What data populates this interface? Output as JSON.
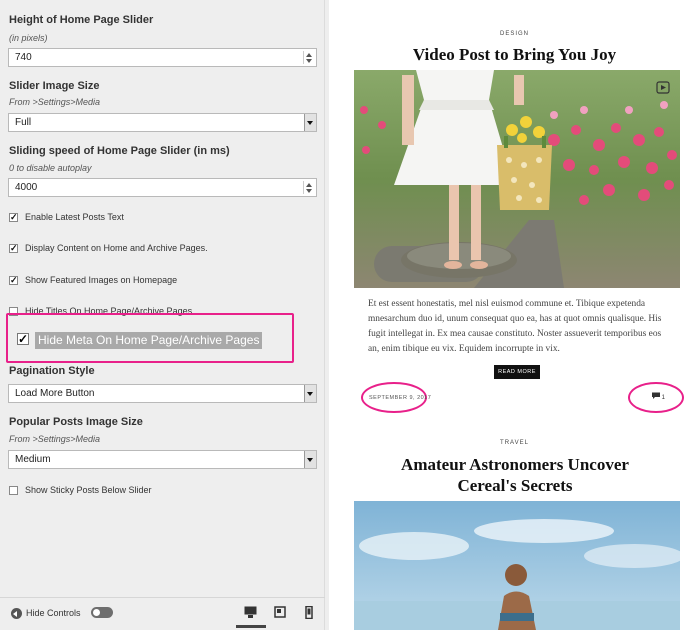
{
  "settings": {
    "slider_height": {
      "label": "Height of Home Page Slider",
      "hint": "(in pixels)",
      "value": "740"
    },
    "slider_image_size": {
      "label": "Slider Image Size",
      "hint": "From >Settings>Media",
      "value": "Full"
    },
    "slider_speed": {
      "label": "Sliding speed of Home Page Slider (in ms)",
      "hint": "0 to disable autoplay",
      "value": "4000"
    },
    "checkboxes": [
      {
        "label": "Enable Latest Posts Text",
        "checked": true
      },
      {
        "label": "Display Content on Home and Archive Pages.",
        "checked": true
      },
      {
        "label": "Show Featured Images on Homepage",
        "checked": true
      },
      {
        "label": "Hide Titles On Home Page/Archive Pages",
        "checked": false
      }
    ],
    "hide_meta": {
      "label": "Hide Meta On Home Page/Archive Pages",
      "checked": true
    },
    "pagination": {
      "label": "Pagination Style",
      "value": "Load More Button"
    },
    "popular_image_size": {
      "label": "Popular Posts Image Size",
      "hint": "From >Settings>Media",
      "value": "Medium"
    },
    "sticky": {
      "label": "Show Sticky Posts Below Slider",
      "checked": false
    }
  },
  "footer": {
    "hide_controls": "Hide Controls",
    "devices": [
      "desktop-icon",
      "tablet-icon",
      "mobile-icon"
    ]
  },
  "preview": {
    "post1": {
      "category": "DESIGN",
      "title": "Video Post to Bring You Joy",
      "excerpt": "Et est essent honestatis, mel nisl euismod commune et. Tibique expetenda mnesarchum duo id, unum consequat quo ea, has at quot omnis qualisque. His fugit intellegat in. Ex mea causae constituto. Noster assueverit temporibus eos an, enim tibique eu vix. Equidem incorrupte in vix.",
      "read_more": "READ MORE",
      "date": "SEPTEMBER 9, 2017",
      "comments": "1"
    },
    "post2": {
      "category": "TRAVEL",
      "title": "Amateur Astronomers Uncover Cereal's Secrets"
    }
  },
  "colors": {
    "highlight": "#e8208a",
    "panel_bg": "#eeeeee"
  }
}
